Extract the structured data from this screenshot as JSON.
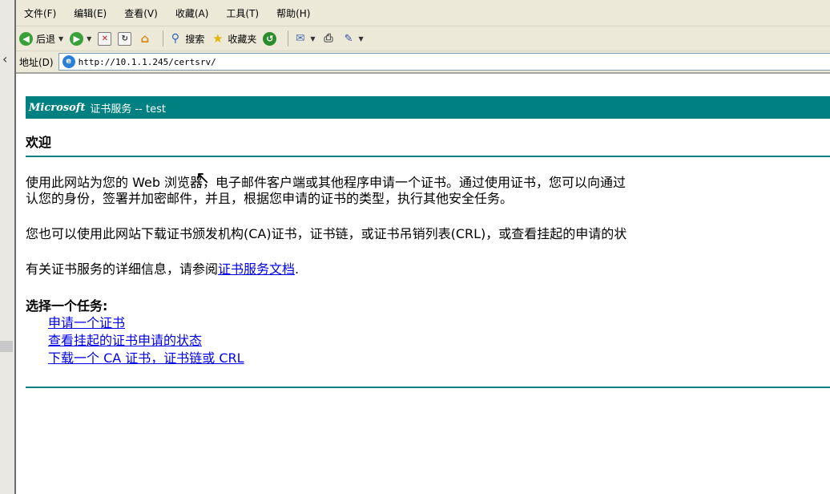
{
  "menubar": [
    "文件(F)",
    "编辑(E)",
    "查看(V)",
    "收藏(A)",
    "工具(T)",
    "帮助(H)"
  ],
  "toolbar": {
    "back": "后退",
    "search": "搜索",
    "favorites": "收藏夹"
  },
  "address": {
    "label": "地址(D)",
    "url": "http://10.1.1.245/certsrv/"
  },
  "page": {
    "banner_brand": "Microsoft",
    "banner_title": "证书服务 --  test",
    "welcome": "欢迎",
    "p1_line1": "使用此网站为您的 Web 浏览器，电子邮件客户端或其他程序申请一个证书。通过使用证书，您可以向通过",
    "p1_line2": "认您的身份，签署并加密邮件，并且，根据您申请的证书的类型，执行其他安全任务。",
    "p2": "您也可以使用此网站下载证书颁发机构(CA)证书，证书链，或证书吊销列表(CRL)，或查看挂起的申请的状",
    "p3_prefix": "有关证书服务的详细信息，请参阅",
    "p3_link": "证书服务文档",
    "p3_suffix": ".",
    "tasks_title": "选择一个任务:",
    "tasks": [
      "申请一个证书",
      "查看挂起的证书申请的状态",
      "下载一个 CA 证书，证书链或 CRL"
    ]
  },
  "colors": {
    "banner": "#008080",
    "link": "#0000ee",
    "chrome": "#ece9d8"
  }
}
